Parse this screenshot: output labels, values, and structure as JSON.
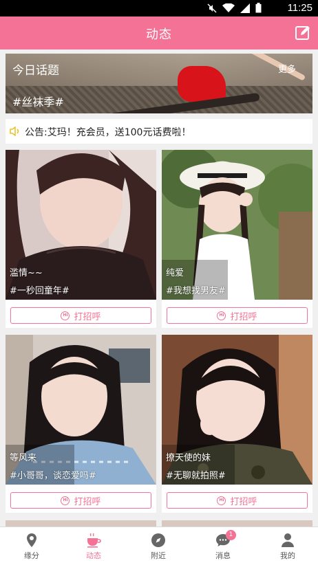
{
  "status_bar": {
    "time": "11:25"
  },
  "app_bar": {
    "title": "动态"
  },
  "banner": {
    "title": "今日话题",
    "more": "更多",
    "tag": "#丝袜季#"
  },
  "notice": {
    "text": "公告:艾玛！充会员，送100元话费啦！"
  },
  "cards": [
    {
      "name": "滥情~~",
      "topic": "#一秒回童年#",
      "button": "打招呼"
    },
    {
      "name": "纯爱",
      "topic": "#我想找男友#",
      "button": "打招呼"
    },
    {
      "name": "等风来",
      "topic": "#小哥哥，谈恋爱吗#",
      "button": "打招呼"
    },
    {
      "name": "撩天使的妹",
      "topic": "#无聊就拍照#",
      "button": "打招呼"
    }
  ],
  "tabs": [
    {
      "label": "缘分",
      "icon": "location-pin-icon"
    },
    {
      "label": "动态",
      "icon": "coffee-cup-icon",
      "active": true
    },
    {
      "label": "附近",
      "icon": "compass-icon"
    },
    {
      "label": "消息",
      "icon": "chat-bubble-icon",
      "badge": "1"
    },
    {
      "label": "我的",
      "icon": "person-icon"
    }
  ],
  "colors": {
    "accent": "#f37296"
  }
}
